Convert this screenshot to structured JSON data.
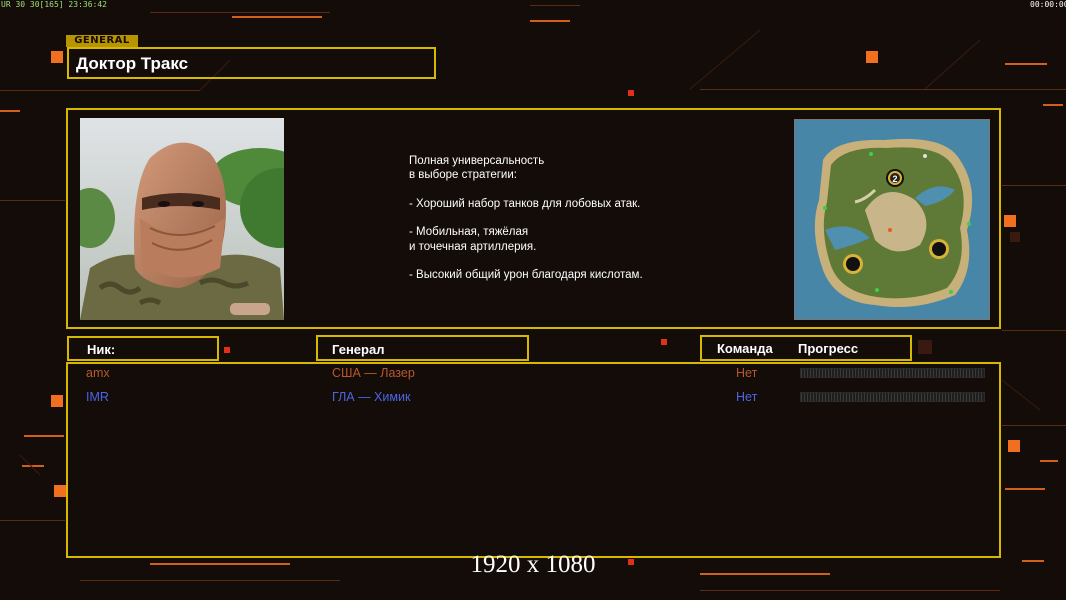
{
  "hud": {
    "top_left_stats": "UR 30 30[165] 23:36:42",
    "top_right_timer": "00:00:00"
  },
  "general": {
    "tag": "GENERAL",
    "name": "Доктор Тракс"
  },
  "description": "Полная универсальность\nв выборе стратегии:\n\n- Хороший набор танков для лобовых атак.\n\n- Мобильная, тяжёлая\nи точечная артиллерия.\n\n- Высокий общий урон благодаря кислотам.",
  "map": {
    "marker_label": "2"
  },
  "table": {
    "headers": {
      "nick": "Ник:",
      "general": "Генерал",
      "team": "Команда",
      "progress": "Прогресс"
    },
    "rows": [
      {
        "nick": "amx",
        "general": "США — Лазер",
        "team": "Нет",
        "color": "#b8582e",
        "progress": 0
      },
      {
        "nick": "IMR",
        "general": "ГЛА — Химик",
        "team": "Нет",
        "color": "#4a66e6",
        "progress": 0
      }
    ]
  },
  "resolution_label": "1920 x 1080",
  "colors": {
    "frame": "#d6b800",
    "background": "#140c08",
    "accent": "#f07020"
  }
}
